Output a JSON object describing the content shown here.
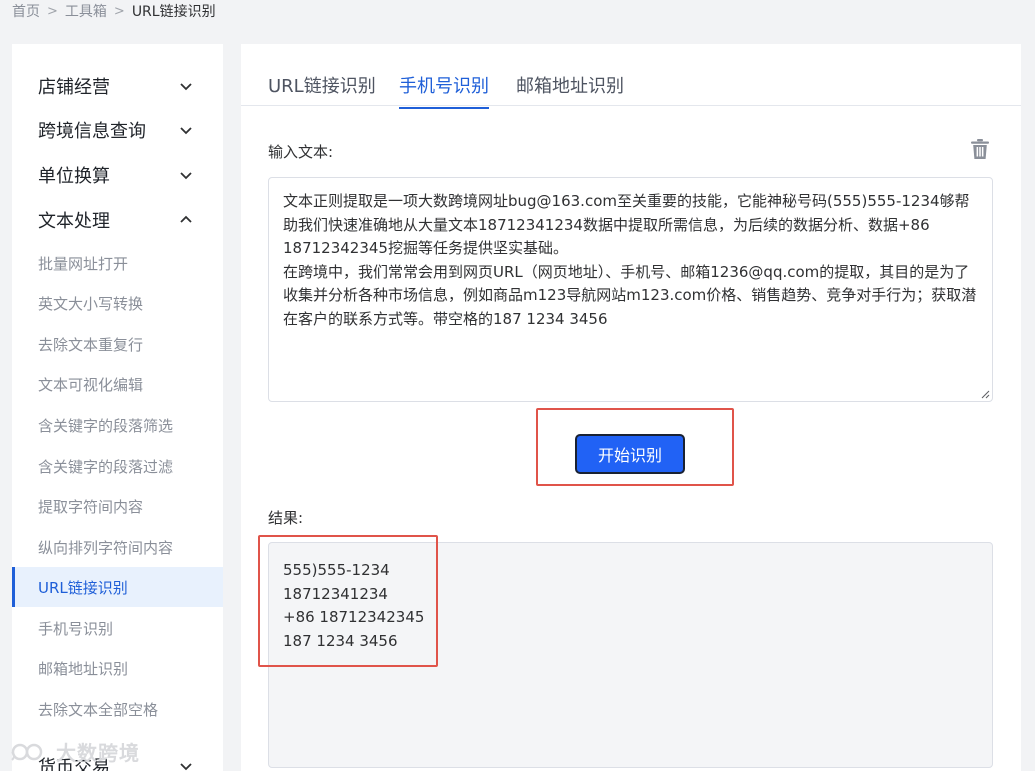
{
  "breadcrumb": {
    "home": "首页",
    "toolbox": "工具箱",
    "current": "URL链接识别",
    "separator": ">"
  },
  "sidebar": {
    "groups": [
      {
        "label": "店铺经营"
      },
      {
        "label": "跨境信息查询"
      },
      {
        "label": "单位换算"
      },
      {
        "label": "文本处理"
      },
      {
        "label": "货币交易"
      }
    ],
    "subitems": [
      {
        "label": "批量网址打开"
      },
      {
        "label": "英文大小写转换"
      },
      {
        "label": "去除文本重复行"
      },
      {
        "label": "文本可视化编辑"
      },
      {
        "label": "含关键字的段落筛选"
      },
      {
        "label": "含关键字的段落过滤"
      },
      {
        "label": "提取字符间内容"
      },
      {
        "label": "纵向排列字符间内容"
      },
      {
        "label": "URL链接识别"
      },
      {
        "label": "手机号识别"
      },
      {
        "label": "邮箱地址识别"
      },
      {
        "label": "去除文本全部空格"
      }
    ],
    "active_subitem": "URL链接识别"
  },
  "tabs": [
    {
      "label": "URL链接识别"
    },
    {
      "label": "手机号识别"
    },
    {
      "label": "邮箱地址识别"
    }
  ],
  "active_tab": "手机号识别",
  "input": {
    "label": "输入文本:",
    "paragraph1": "文本正则提取是一项大数跨境网址bug@163.com至关重要的技能，它能神秘号码(555)555-1234够帮助我们快速准确地从大量文本18712341234数据中提取所需信息，为后续的数据分析、数据+86 18712342345挖掘等任务提供坚实基础。",
    "paragraph2": "在跨境中，我们常常会用到网页URL（网页地址）、手机号、邮箱1236@qq.com的提取，其目的是为了收集并分析各种市场信息，例如商品m123导航网站m123.com价格、销售趋势、竞争对手行为；获取潜在客户的联系方式等。带空格的187 1234 3456"
  },
  "button": {
    "label": "开始识别"
  },
  "result": {
    "label": "结果:",
    "lines": [
      "555)555-1234",
      "18712341234",
      "+86 18712342345",
      "187 1234 3456"
    ]
  },
  "watermark": {
    "text": "大数跨境"
  },
  "colors": {
    "accent": "#2162f5",
    "active_text": "#1f5fd8",
    "highlight": "#e0544a"
  },
  "icons": {
    "trash": "trash-icon",
    "chevron_down": "chevron-down-icon",
    "chevron_up": "chevron-up-icon"
  }
}
